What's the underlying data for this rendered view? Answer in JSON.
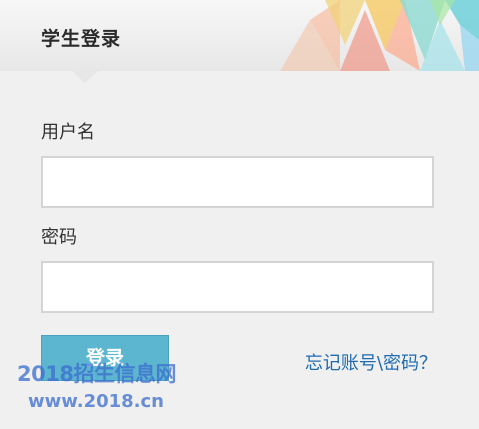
{
  "header": {
    "title": "学生登录"
  },
  "form": {
    "username_label": "用户名",
    "username_value": "",
    "password_label": "密码",
    "password_value": "",
    "login_button": "登录",
    "forgot_link": "忘记账号\\密码？"
  },
  "watermark": {
    "line1": "2018招生信息网",
    "line2": "www.2018.cn"
  },
  "colors": {
    "accent": "#5db6d0",
    "link": "#1e6bb0",
    "background": "#f0f0f0"
  }
}
